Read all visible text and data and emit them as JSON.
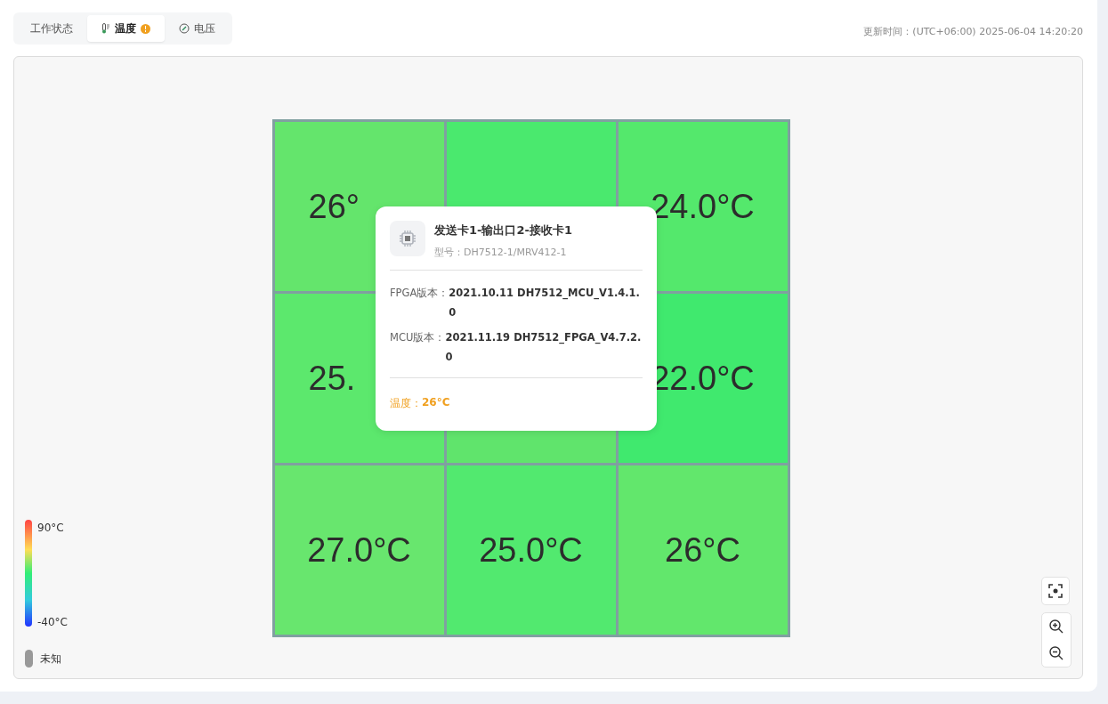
{
  "tabs": [
    {
      "label": "工作状态",
      "alert": false,
      "selected": false
    },
    {
      "label": "温度",
      "alert": true,
      "selected": true
    },
    {
      "label": "电压",
      "alert": false,
      "selected": false
    }
  ],
  "update_time": "更新时间：(UTC+06:00) 2025-06-04 14:20:20",
  "cells": [
    {
      "kind": "clipped",
      "value": "26°",
      "color": "#64e56c"
    },
    {
      "color": "#4ae96e"
    },
    {
      "value": "24.0°C",
      "color": "#54e86c"
    },
    {
      "kind": "clipped",
      "value": "25.",
      "color": "#5ce86d"
    },
    {
      "color": "#60e46c"
    },
    {
      "value": "22.0°C",
      "color": "#40e96e"
    },
    {
      "value": "27.0°C",
      "color": "#68e66e"
    },
    {
      "value": "25.0°C",
      "color": "#52e96f"
    },
    {
      "value": "26°C",
      "color": "#62e76c"
    }
  ],
  "tooltip": {
    "title": "发送卡1-输出口2-接收卡1",
    "model": "型号：DH7512-1/MRV412-1",
    "fields": [
      {
        "label": "FPGA版本：",
        "value": "2021.10.11 DH7512_MCU_V1.4.1.0"
      },
      {
        "label": "MCU版本：",
        "value": "2021.11.19 DH7512_FPGA_V4.7.2.0"
      }
    ],
    "temperature_label": "温度：",
    "temperature_value": "26°C"
  },
  "legend": {
    "max": "90°C",
    "min": "-40°C",
    "unknown": "未知"
  }
}
